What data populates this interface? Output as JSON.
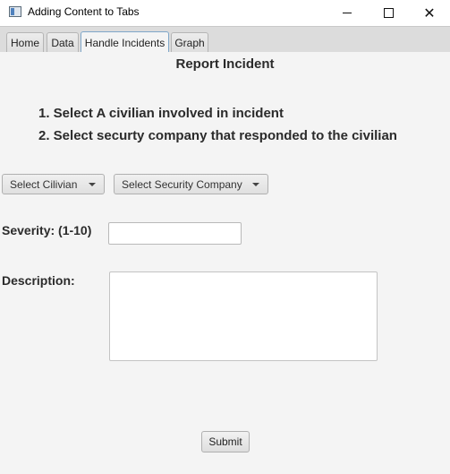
{
  "window": {
    "title": "Adding Content to Tabs",
    "minimize_icon": "minimize-icon",
    "maximize_icon": "maximize-icon",
    "close_glyph": "✕"
  },
  "tabs": [
    {
      "label": "Home",
      "active": false
    },
    {
      "label": "Data",
      "active": false
    },
    {
      "label": "Handle Incidents",
      "active": true
    },
    {
      "label": "Graph",
      "active": false
    }
  ],
  "main": {
    "title": "Report Incident",
    "instructions": [
      "1. Select A civilian involved in incident",
      "2. Select securty company that responded to the civilian"
    ],
    "civilian_combo": {
      "label": "Select Cilivian"
    },
    "security_combo": {
      "label": "Select Security Company"
    },
    "severity": {
      "label": "Severity: (1-10)",
      "value": ""
    },
    "description": {
      "label": "Description:",
      "value": ""
    },
    "submit_label": "Submit"
  },
  "colors": {
    "background": "#f4f4f4",
    "tabbar": "#dcdcdc",
    "active_tab_border": "#7fa7c9",
    "text": "#2b2b2b"
  }
}
